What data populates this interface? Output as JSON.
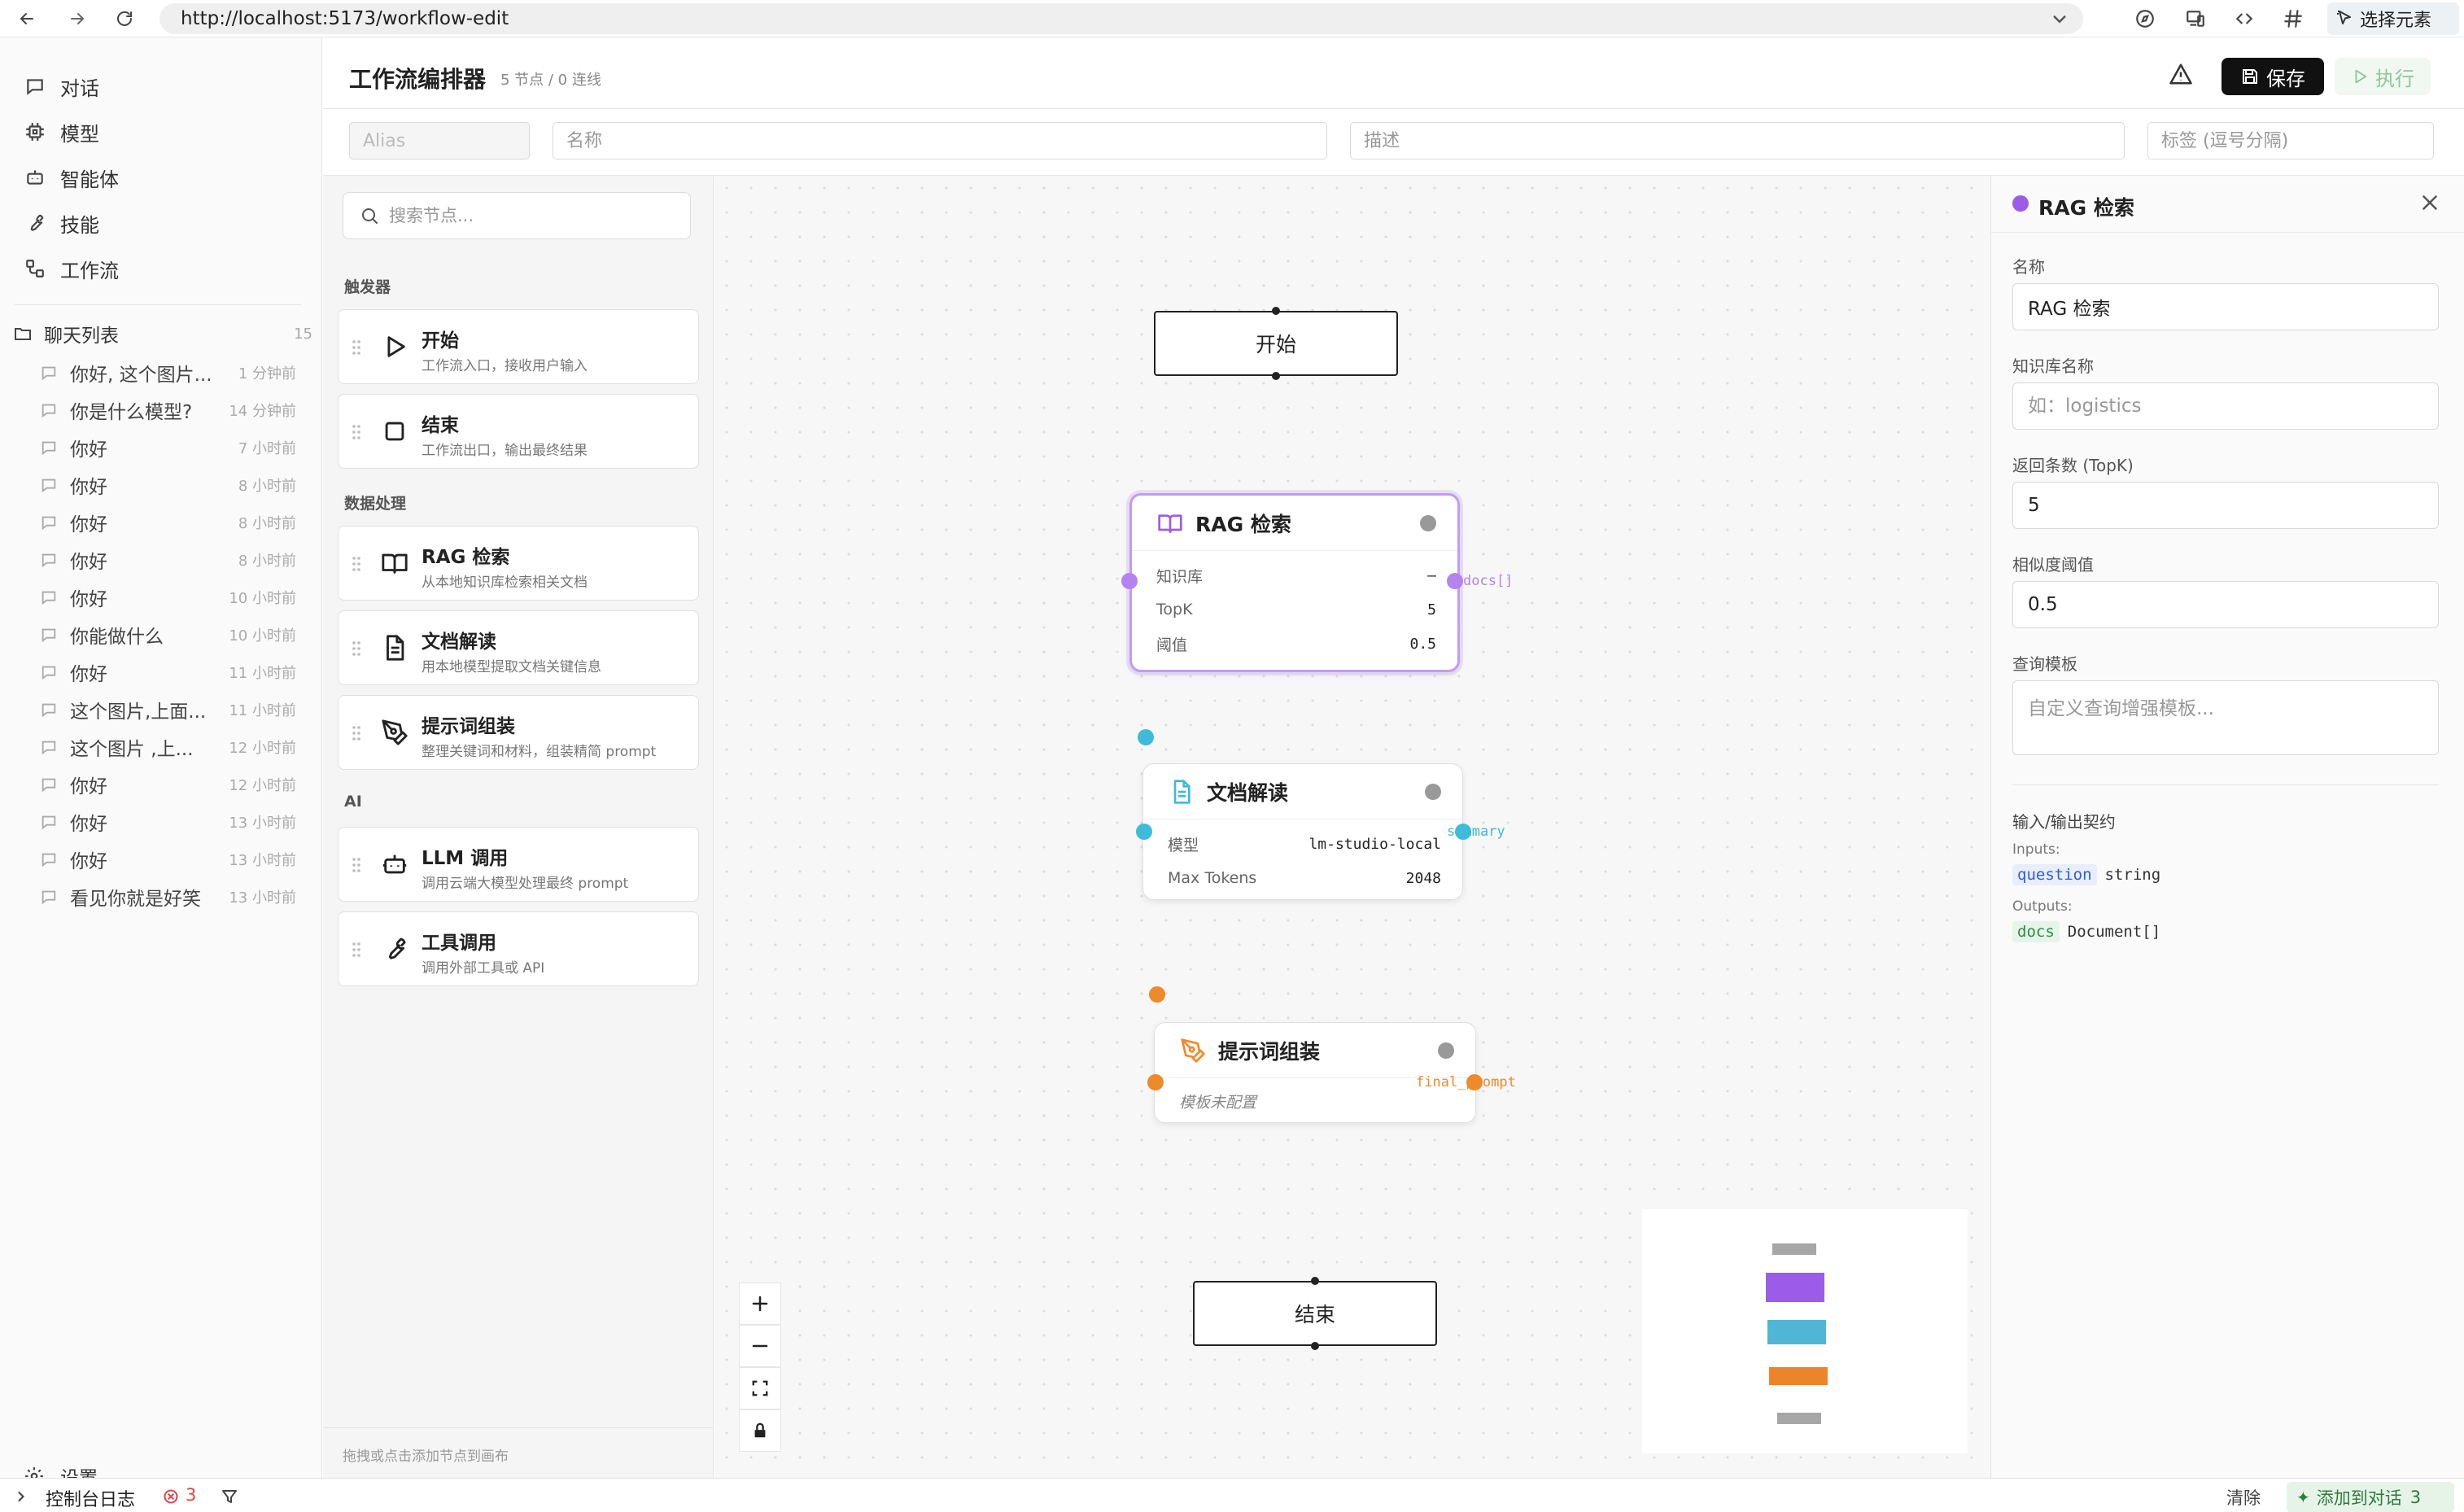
{
  "browser": {
    "url": "http://localhost:5173/workflow-edit",
    "select_element_label": "选择元素"
  },
  "sidebar": {
    "nav": [
      {
        "label": "对话",
        "icon": "chat-icon"
      },
      {
        "label": "模型",
        "icon": "cpu-icon"
      },
      {
        "label": "智能体",
        "icon": "bot-icon"
      },
      {
        "label": "技能",
        "icon": "wrench-icon"
      },
      {
        "label": "工作流",
        "icon": "workflow-icon"
      }
    ],
    "chat_list_label": "聊天列表",
    "chat_count": "15",
    "chats": [
      {
        "title": "你好, 这个图片...",
        "time": "1 分钟前"
      },
      {
        "title": "你是什么模型?",
        "time": "14 分钟前"
      },
      {
        "title": "你好",
        "time": "7 小时前"
      },
      {
        "title": "你好",
        "time": "8 小时前"
      },
      {
        "title": "你好",
        "time": "8 小时前"
      },
      {
        "title": "你好",
        "time": "8 小时前"
      },
      {
        "title": "你好",
        "time": "10 小时前"
      },
      {
        "title": "你能做什么",
        "time": "10 小时前"
      },
      {
        "title": "你好",
        "time": "11 小时前"
      },
      {
        "title": "这个图片,上面...",
        "time": "11 小时前"
      },
      {
        "title": "这个图片 ,上...",
        "time": "12 小时前"
      },
      {
        "title": "你好",
        "time": "12 小时前"
      },
      {
        "title": "你好",
        "time": "13 小时前"
      },
      {
        "title": "你好",
        "time": "13 小时前"
      },
      {
        "title": "看见你就是好笑",
        "time": "13 小时前"
      }
    ],
    "settings_label": "设置"
  },
  "console": {
    "label": "控制台日志",
    "error_count": "3",
    "clear_label": "清除",
    "add_label": "添加到对话",
    "add_count": "3"
  },
  "header": {
    "title": "工作流编排器",
    "stats": "5 节点 / 0 连线",
    "save_label": "保存",
    "run_label": "执行"
  },
  "meta": {
    "alias_placeholder": "Alias",
    "name_placeholder": "名称",
    "desc_placeholder": "描述",
    "tags_placeholder": "标签 (逗号分隔)"
  },
  "palette": {
    "search_placeholder": "搜索节点...",
    "sections": [
      {
        "label": "触发器",
        "items": [
          {
            "title": "开始",
            "desc": "工作流入口，接收用户输入",
            "icon": "play-icon"
          },
          {
            "title": "结束",
            "desc": "工作流出口，输出最终结果",
            "icon": "stop-square-icon"
          }
        ]
      },
      {
        "label": "数据处理",
        "items": [
          {
            "title": "RAG 检索",
            "desc": "从本地知识库检索相关文档",
            "icon": "book-open-icon"
          },
          {
            "title": "文档解读",
            "desc": "用本地模型提取文档关键信息",
            "icon": "file-text-icon"
          },
          {
            "title": "提示词组装",
            "desc": "整理关键词和材料，组装精简 prompt",
            "icon": "pen-tool-icon"
          }
        ]
      },
      {
        "label": "AI",
        "items": [
          {
            "title": "LLM 调用",
            "desc": "调用云端大模型处理最终 prompt",
            "icon": "bot-icon"
          },
          {
            "title": "工具调用",
            "desc": "调用外部工具或 API",
            "icon": "wrench-icon"
          }
        ]
      }
    ],
    "footer_hint": "拖拽或点击添加节点到画布"
  },
  "canvas": {
    "start_label": "开始",
    "end_label": "结束",
    "rag_node": {
      "title": "RAG 检索",
      "rows": [
        {
          "label": "知识库",
          "value": "—"
        },
        {
          "label": "TopK",
          "value": "5"
        },
        {
          "label": "阈值",
          "value": "0.5"
        }
      ],
      "output_port": "docs[]",
      "color": "#9c5ce8"
    },
    "doc_node": {
      "title": "文档解读",
      "rows": [
        {
          "label": "模型",
          "value": "lm-studio-local"
        },
        {
          "label": "Max Tokens",
          "value": "2048"
        }
      ],
      "output_port": "summary",
      "color": "#3ebbd9"
    },
    "prompt_node": {
      "title": "提示词组装",
      "placeholder": "模板未配置",
      "output_port": "final_prompt",
      "color": "#ee8a2a"
    }
  },
  "inspector": {
    "title": "RAG 检索",
    "name_label": "名称",
    "name_value": "RAG 检索",
    "kb_label": "知识库名称",
    "kb_placeholder": "如：logistics",
    "topk_label": "返回条数 (TopK)",
    "topk_value": "5",
    "threshold_label": "相似度阈值",
    "threshold_value": "0.5",
    "template_label": "查询模板",
    "template_placeholder": "自定义查询增强模板...",
    "io_title": "输入/输出契约",
    "inputs_label": "Inputs:",
    "inputs": [
      {
        "name": "question",
        "type": "string"
      }
    ],
    "outputs_label": "Outputs:",
    "outputs": [
      {
        "name": "docs",
        "type": "Document[]"
      }
    ]
  }
}
